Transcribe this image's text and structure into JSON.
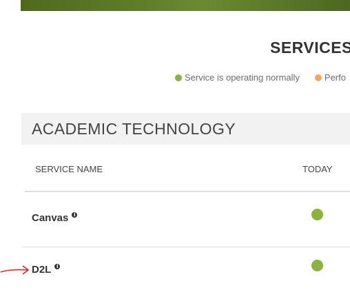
{
  "header": {
    "title": "SERVICES"
  },
  "legend": {
    "items": [
      {
        "label": "Service is operating normally",
        "color": "#8ab33f",
        "icon": "green-dot"
      },
      {
        "label": "Perfo",
        "color": "#f0a95a",
        "icon": "orange-dot"
      }
    ]
  },
  "category": {
    "title": "ACADEMIC TECHNOLOGY"
  },
  "table": {
    "columns": [
      "SERVICE NAME",
      "TODAY"
    ],
    "rows": [
      {
        "name": "Canvas",
        "status": "operating-normally",
        "status_color": "#8ab33f",
        "info_icon": "info-icon"
      },
      {
        "name": "D2L",
        "status": "operating-normally",
        "status_color": "#8ab33f",
        "info_icon": "info-icon"
      }
    ]
  },
  "colors": {
    "banner": "#5b7a28",
    "annotation_arrow": "#d42020"
  }
}
